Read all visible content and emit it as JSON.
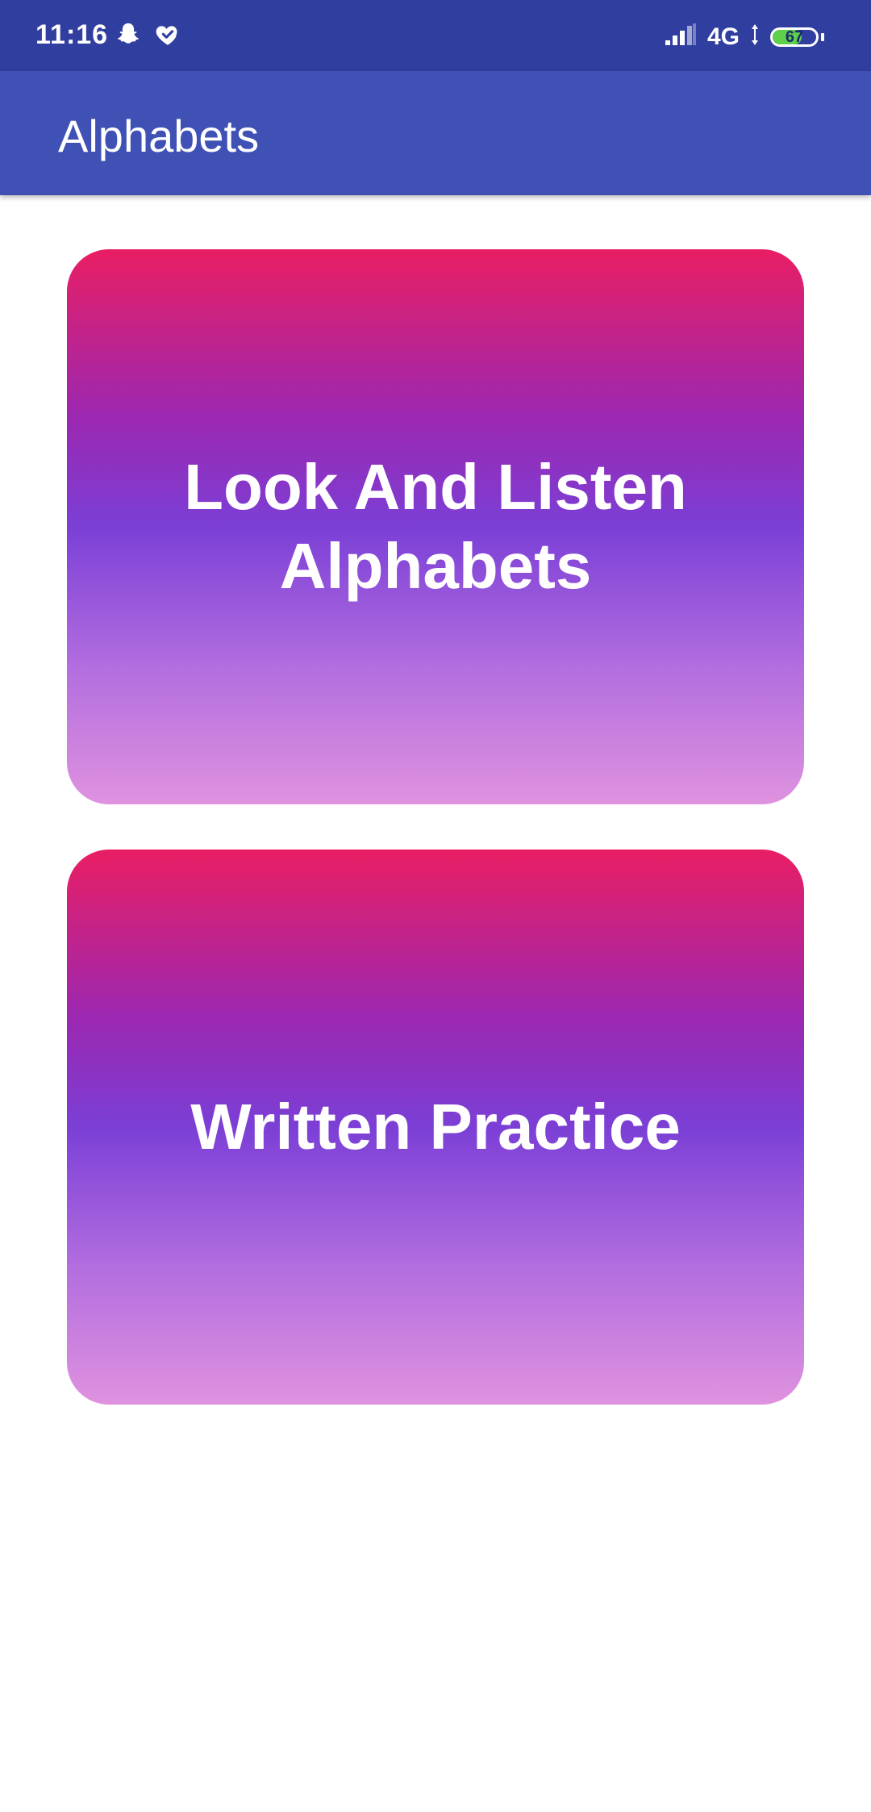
{
  "status_bar": {
    "time": "11:16",
    "network": "4G",
    "battery": "67",
    "battery_level": 0.67,
    "icons": [
      "snapchat-icon",
      "health-heart-icon",
      "signal-icon"
    ]
  },
  "app_bar": {
    "title": "Alphabets"
  },
  "menu": {
    "items": [
      {
        "label": "Look And Listen Alphabets"
      },
      {
        "label": "Written Practice"
      }
    ]
  },
  "colors": {
    "status_bar": "#303f9f",
    "app_bar": "#3f51b5",
    "gradient_top": "#e91e63",
    "gradient_mid": "#7b3fd6",
    "gradient_bottom": "#df92df"
  }
}
